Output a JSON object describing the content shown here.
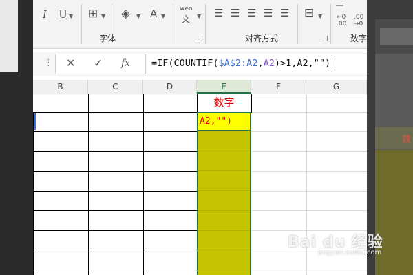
{
  "ribbon": {
    "font_group_label": "字体",
    "align_group_label": "对齐方式",
    "number_group_label": "数字",
    "italic_label": "I",
    "underline_label": "U",
    "font_color_label": "A",
    "phonetic_top": "wén",
    "phonetic_bottom": "文",
    "decimal_inc_label": "←0\n.00",
    "decimal_dec_label": ".00\n→0"
  },
  "formula_bar": {
    "name_box_dots": "⋮",
    "cancel_icon": "✕",
    "enter_icon": "✓",
    "fx_label": "fx",
    "formula_prefix": "=IF(COUNTIF(",
    "formula_ref1": "$A$2:A2",
    "formula_sep": ",",
    "formula_ref2": "A2",
    "formula_mid": ")>1,",
    "formula_ref3": "A2",
    "formula_suffix": ",\"\")"
  },
  "sheet": {
    "columns": [
      "B",
      "C",
      "D",
      "E",
      "F",
      "G"
    ],
    "selected_column": "E",
    "e_header_text": "数字",
    "active_cell_text": "A2,\"\")",
    "fill_color": "#c6c300",
    "highlight_color": "#ffff00"
  },
  "watermark": {
    "main": "Bai du 经验",
    "sub": "jingyan.baidu.com"
  },
  "right_peek_text": "数"
}
